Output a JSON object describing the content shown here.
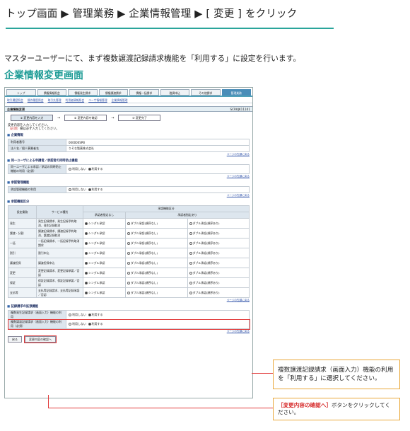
{
  "header": {
    "title": "トップ画面 ▶ 管理業務 ▶ 企業情報管理 ▶ [ 変更 ] をクリック"
  },
  "intro": "マスターユーザーにて、まず複数譲渡記録請求機能を「利用する」に設定を行います。",
  "subhead": "企業情報変更画面",
  "screen": {
    "tabs": [
      "トップ",
      "債権情報照会",
      "債権発生請求",
      "債権譲渡請求",
      "債権一括請求",
      "融資申込",
      "その他請求",
      "管理業務"
    ],
    "subnav": [
      "取引履歴照会",
      "操作履歴照会",
      "取引先管理",
      "利用者情報照会",
      "ユーザ情報管理",
      "企業情報管理"
    ],
    "screen_title": "企業情報変更",
    "screen_id": "SCRKJK11101",
    "steps": [
      "① 変更内容を入力",
      "② 変更内容を確認",
      "③ 変更完了"
    ],
    "note_line1": "変更内容を入力してください。",
    "note_line2_req": "（必須）",
    "note_line2": "欄は必ず入力してください。",
    "sections": {
      "company": "企業情報",
      "same_user": "同一ユーザによる申請者／承認者の同時防止機能",
      "approval_mgmt": "承認管理機能",
      "approval_cat": "承認機能区分",
      "multi_transfer": "記録請求の拡張機能"
    },
    "company_rows": [
      {
        "label": "利用者番号",
        "value": "000000SPB"
      },
      {
        "label": "法人名／個人事業者名",
        "value": "りそな製菓株式会社"
      }
    ],
    "same_user_row": {
      "label": "同一ユーザによる承認／承認の同時防止機能の利用（必須）",
      "opt1": "利用しない",
      "opt2": "利用する"
    },
    "approval_row": {
      "label": "承認管理機能の利用",
      "opt1": "利用しない",
      "opt2": "利用する"
    },
    "toplink": "ページの先頭に戻る",
    "grid": {
      "h_category": "設定業務",
      "h_service": "サービス種別",
      "h_approval": "承認機能区分",
      "h_none": "承認者指定なし",
      "h_with": "承認者指定あり",
      "opt_single": "シングル承認",
      "opt_double_no": "ダブル承認(順序なし)",
      "opt_double_yes": "ダブル承認(順序あり)",
      "rows": [
        {
          "cat": "発生",
          "svc": "発生記録請求、発生記録予約取消、発生記録取消"
        },
        {
          "cat": "譲渡・分割",
          "svc": "譲渡記録請求、譲渡記録予約取消、譲渡記録取消"
        },
        {
          "cat": "一括",
          "svc": "一括記録請求、一括記録予約取消請求"
        },
        {
          "cat": "割引",
          "svc": "割引申込"
        },
        {
          "cat": "譲渡担保",
          "svc": "譲渡担保申込"
        },
        {
          "cat": "変更",
          "svc": "変更記録請求、変更記録承諾／否認"
        },
        {
          "cat": "保証",
          "svc": "保証記録請求、保証記録承諾／否認"
        },
        {
          "cat": "支払等",
          "svc": "支払等記録請求、支払等記録承諾／否認"
        }
      ]
    },
    "multi_rows": [
      {
        "label": "複数発生記録請求（画面入力）機能の利用",
        "opt1": "利用しない",
        "opt2": "利用する"
      },
      {
        "label": "複数譲渡記録請求（画面入力）機能の利用（必須）",
        "opt1": "利用しない",
        "opt2": "利用する"
      }
    ],
    "back_button": "戻る",
    "confirm_button": "変更内容の確認へ"
  },
  "callout1": "複数譲渡記録請求（画面入力）機能の利用を「利用する」に選択してください。",
  "callout2_red": "［変更内容の確認へ］",
  "callout2_rest": "ボタンをクリックしてください。"
}
